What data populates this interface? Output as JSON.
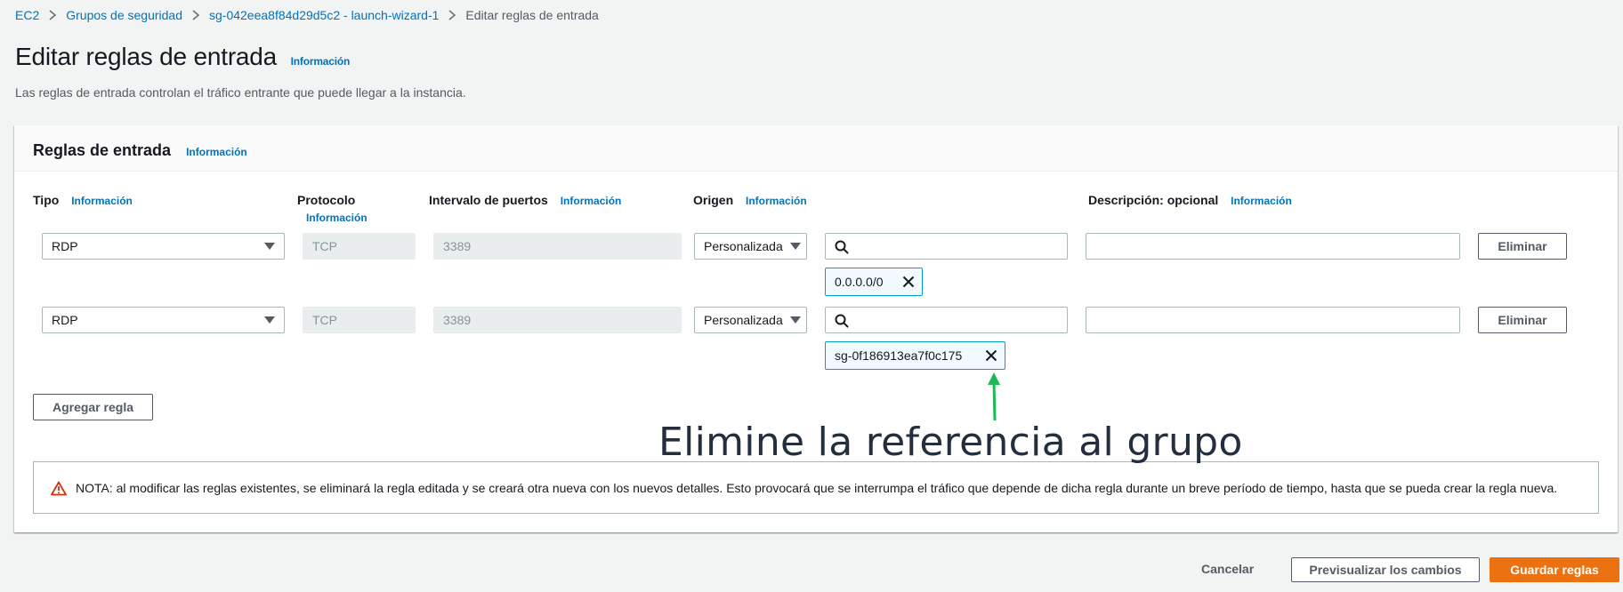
{
  "breadcrumb": {
    "items": [
      "EC2",
      "Grupos de seguridad",
      "sg-042eea8f84d29d5c2 - launch-wizard-1",
      "Editar reglas de entrada"
    ]
  },
  "page": {
    "title": "Editar reglas de entrada",
    "info": "Información",
    "description": "Las reglas de entrada controlan el tráfico entrante que puede llegar a la instancia."
  },
  "panel": {
    "title": "Reglas de entrada",
    "info": "Información"
  },
  "columns": {
    "tipo": "Tipo",
    "tipo_info": "Información",
    "protocolo": "Protocolo",
    "protocolo_info": "Información",
    "puertos": "Intervalo de puertos",
    "puertos_info": "Información",
    "origen": "Origen",
    "origen_info": "Información",
    "descripcion": "Descripción: opcional",
    "descripcion_info": "Información"
  },
  "rules": [
    {
      "type": "RDP",
      "protocol": "TCP",
      "port": "3389",
      "source_type": "Personalizada",
      "token": "0.0.0.0/0",
      "description": "",
      "delete_label": "Eliminar"
    },
    {
      "type": "RDP",
      "protocol": "TCP",
      "port": "3389",
      "source_type": "Personalizada",
      "token": "sg-0f186913ea7f0c175",
      "description": "",
      "delete_label": "Eliminar"
    }
  ],
  "add_rule_label": "Agregar regla",
  "note": "NOTA: al modificar las reglas existentes, se eliminará la regla editada y se creará otra nueva con los nuevos detalles. Esto provocará que se interrumpa el tráfico que depende de dicha regla durante un breve período de tiempo, hasta que se pueda crear la regla nueva.",
  "annotation": "Elimine la referencia al grupo",
  "footer": {
    "cancel": "Cancelar",
    "preview": "Previsualizar los cambios",
    "save": "Guardar reglas"
  },
  "colors": {
    "link": "#0073bb",
    "primary": "#ec7211",
    "token_border": "#00a1c9",
    "warning": "#d13212",
    "annotation_arrow": "#1db954"
  },
  "icons": [
    "chevron-right-icon",
    "caret-down-icon",
    "search-icon",
    "close-icon",
    "warning-icon",
    "arrow-up-icon"
  ]
}
